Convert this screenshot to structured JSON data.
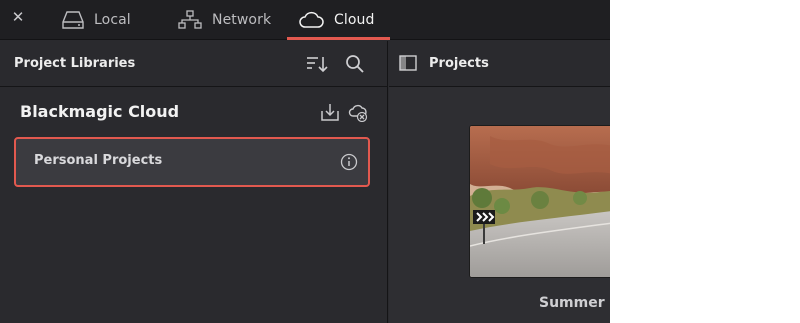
{
  "tabs": [
    {
      "label": "Local",
      "icon": "drive-icon"
    },
    {
      "label": "Network",
      "icon": "network-icon"
    },
    {
      "label": "Cloud",
      "icon": "cloud-icon",
      "active": true
    }
  ],
  "close_icon": "close-icon",
  "left_panel": {
    "title": "Project Libraries",
    "icons": [
      "sort-icon",
      "search-icon"
    ],
    "group": {
      "title": "Blackmagic Cloud",
      "icons": [
        "download-icon",
        "cloud-disconnect-icon"
      ],
      "items": [
        {
          "label": "Personal Projects",
          "selected": true,
          "icon": "info-icon"
        }
      ]
    }
  },
  "right_panel": {
    "title": "Projects",
    "icon": "sidebar-toggle-icon",
    "project": {
      "label": "Summer H"
    }
  },
  "colors": {
    "accent": "#e2594f",
    "background": "#2a2a2e",
    "tabbar": "#1f1f22"
  }
}
